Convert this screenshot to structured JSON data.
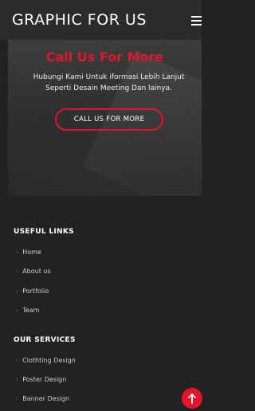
{
  "header": {
    "brand": "GRAPHIC FOR US"
  },
  "hero": {
    "title": "Call Us For More",
    "text_line1": "Hubungi Kami Untuk iformasi Lebih Lanjut",
    "text_line2": "Seperti Desain Meeting Dan lainya.",
    "cta_label": "CALL US FOR MORE"
  },
  "useful_links": {
    "title": "USEFUL LINKS",
    "items": [
      "Home",
      "About us",
      "Portfolio",
      "Team"
    ]
  },
  "our_services": {
    "title": "OUR SERVICES",
    "items": [
      "Clothting Design",
      "Poster Design",
      "Banner Design"
    ]
  },
  "colors": {
    "accent": "#e0162b",
    "background": "#222222"
  },
  "icons": {
    "menu": "hamburger-menu-icon",
    "chevron": "chevron-right-icon",
    "scroll_top": "arrow-up-icon"
  }
}
